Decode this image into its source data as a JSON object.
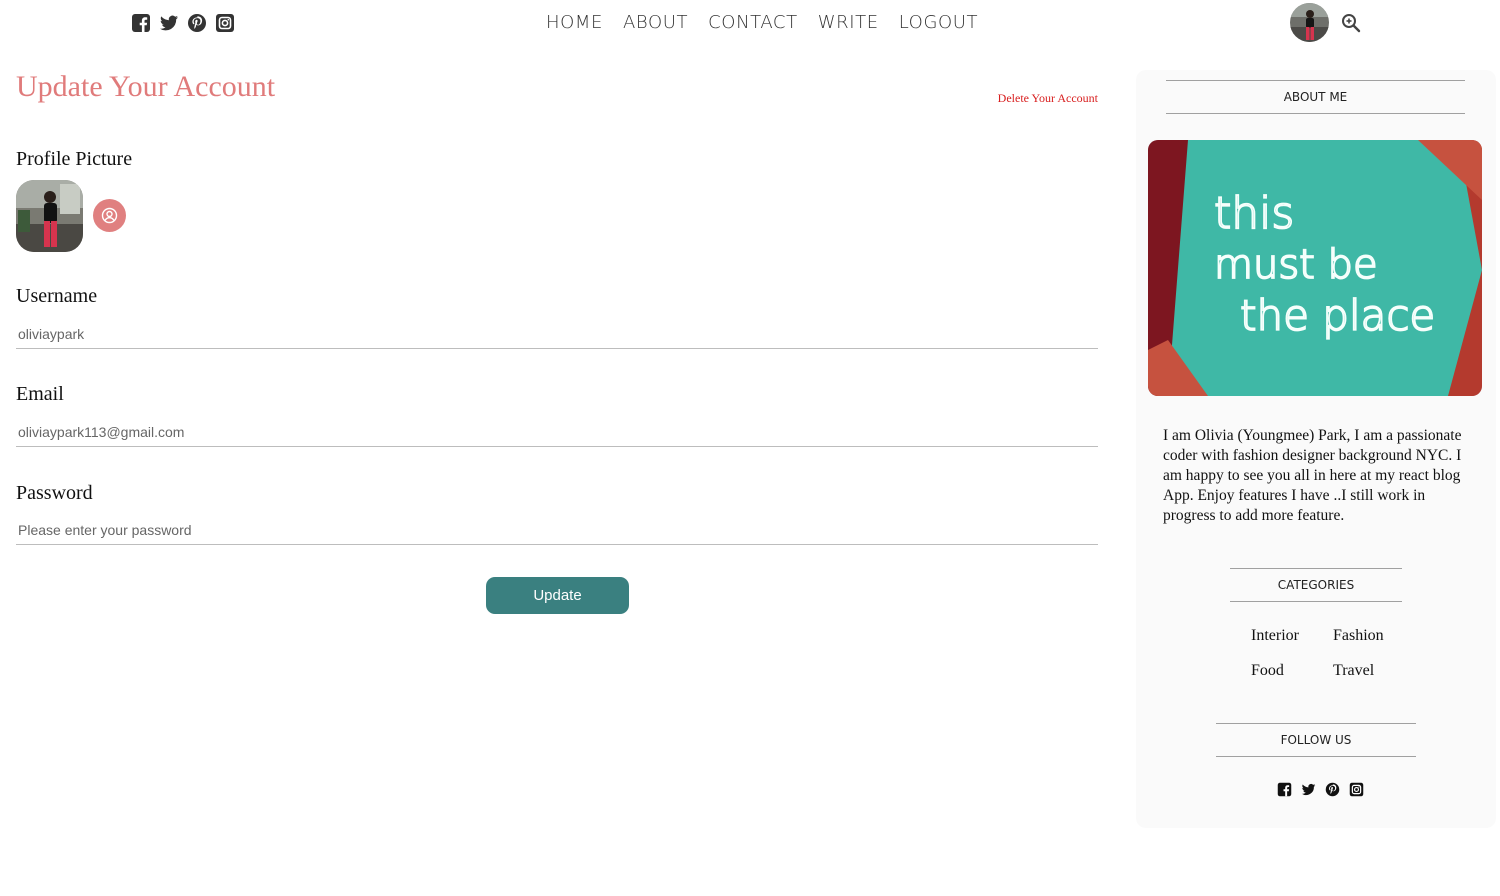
{
  "nav": {
    "social": [
      "facebook-icon",
      "twitter-icon",
      "pinterest-icon",
      "instagram-icon"
    ],
    "links": [
      "HOME",
      "ABOUT",
      "CONTACT",
      "WRITE",
      "LOGOUT"
    ]
  },
  "settings": {
    "title": "Update Your Account",
    "delete_label": "Delete Your Account",
    "profile_picture_label": "Profile Picture",
    "username_label": "Username",
    "username_placeholder": "oliviaypark",
    "email_label": "Email",
    "email_placeholder": "oliviaypark113@gmail.com",
    "password_label": "Password",
    "password_placeholder": "Please enter your password",
    "update_label": "Update"
  },
  "sidebar": {
    "about_title": "ABOUT ME",
    "neon_sign": [
      "this",
      "must be",
      "the place"
    ],
    "about_text": "I am Olivia (Youngmee) Park, I am a passionate coder with fashion designer background NYC. I am happy to see you all in here at my react blog App. Enjoy features I have ..I still work in progress to add more feature.",
    "categories_title": "CATEGORIES",
    "categories": [
      "Interior",
      "Fashion",
      "Food",
      "Travel"
    ],
    "follow_title": "FOLLOW US"
  },
  "colors": {
    "accent": "#e07b7b",
    "delete": "#d81e1e",
    "button": "#3a8080",
    "neon_wall": "#3fb8a6"
  }
}
